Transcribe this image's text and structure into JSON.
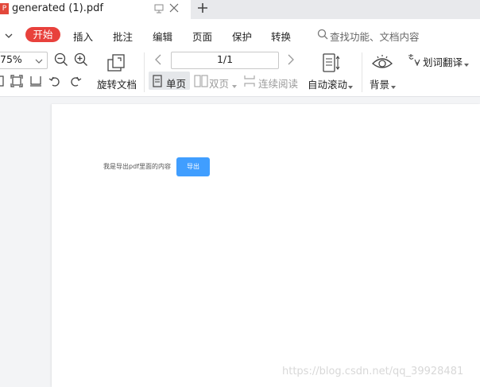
{
  "tab": {
    "icon_letter": "P",
    "title": "generated (1).pdf"
  },
  "menu": {
    "start": "开始",
    "items": [
      "插入",
      "批注",
      "编辑",
      "页面",
      "保护",
      "转换"
    ],
    "search_placeholder": "查找功能、文档内容"
  },
  "toolbar": {
    "zoom": "75%",
    "rotate_label": "旋转文档",
    "page_indicator": "1/1",
    "single_page": "单页",
    "double_page": "双页",
    "continuous": "连续阅读",
    "auto_scroll": "自动滚动",
    "background": "背景",
    "translate": "划词翻译"
  },
  "document": {
    "text": "我是导出pdf里面的内容",
    "export_button": "导出"
  },
  "watermark": "https://blog.csdn.net/qq_39928481",
  "colors": {
    "start_button": "#e8413c",
    "export_button": "#409eff"
  }
}
